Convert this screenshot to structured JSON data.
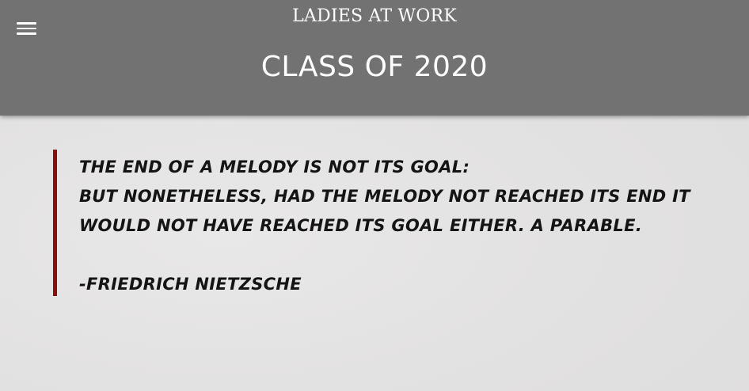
{
  "header": {
    "menu_icon": "hamburger-menu-icon",
    "site_title": "LADIES AT WORK",
    "page_title": "CLASS OF 2020",
    "background_color": "#727272"
  },
  "quote": {
    "lines": [
      "THE END OF A MELODY IS NOT ITS GOAL:",
      "BUT NONETHELESS, HAD THE MELODY NOT REACHED ITS END IT",
      "WOULD NOT HAVE REACHED ITS GOAL EITHER. A PARABLE."
    ],
    "author": "-FRIEDRICH NIETZSCHE",
    "accent_color": "#8b0e0e"
  }
}
